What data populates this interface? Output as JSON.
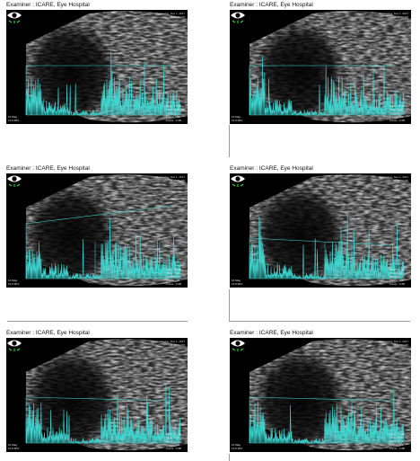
{
  "examiner_label": "Examiner : ICARE, Eye Hospital",
  "colors": {
    "trace": "#3fd7d2",
    "background": "#000000",
    "eye_icon_green": "#2fd23a"
  },
  "panels": [
    {
      "examiner": "Examiner : ICARE, Eye Hospital",
      "timestamp": [
        "Wednesday, Nov 1, 2017",
        "08:02:56 PM"
      ],
      "scan_left": [
        "10 Mag",
        "12.0 Mhz"
      ],
      "scan_right": [
        "Gain : 75 dB",
        "Time : 0-40 mm",
        "Gamma : 0",
        "Frame : 1/1",
        "Focus : 0 dB"
      ]
    },
    {
      "examiner": "Examiner : ICARE, Eye Hospital",
      "timestamp": [
        "Wednesday, Nov 1, 2017",
        "08:02:56 PM"
      ],
      "scan_left": [
        "10 Mag",
        "12.0 Mhz"
      ],
      "scan_right": [
        "Gain : 75 dB",
        "Time : 0-40 mm",
        "Gamma : 0",
        "Frame : 1/1",
        "Focus : 0 dB"
      ]
    },
    {
      "examiner": "Examiner : ICARE, Eye Hospital",
      "timestamp": [
        "Wednesday, Nov 1, 2017",
        "08:02:56 PM"
      ],
      "scan_left": [
        "10 Mag",
        "12.0 Mhz"
      ],
      "scan_right": [
        "Gain : 75 dB",
        "Time : 0-40 mm",
        "Gamma : 0",
        "Frame : 1/1",
        "Focus : 0 dB"
      ]
    },
    {
      "examiner": "Examiner : ICARE, Eye Hospital",
      "timestamp": [
        "Wednesday, Nov 1, 2017",
        "08:02:56 PM"
      ],
      "scan_left": [
        "10 Mag",
        "12.0 Mhz"
      ],
      "scan_right": [
        "Gain : 75 dB",
        "Time : 0-40 mm",
        "Gamma : 0",
        "Frame : 1/1",
        "Focus : 0 dB"
      ]
    },
    {
      "examiner": "Examiner : ICARE, Eye Hospital",
      "timestamp": [
        "Wednesday, Nov 1, 2017",
        "08:02:56 PM"
      ],
      "scan_left": [
        "10 Mag",
        "12.0 Mhz"
      ],
      "scan_right": [
        "Gain : 75 dB",
        "Time : 0-40 mm",
        "Gamma : 0",
        "Frame : 1/1",
        "Focus : 0 dB"
      ]
    },
    {
      "examiner": "Examiner : ICARE, Eye Hospital",
      "timestamp": [
        "Wednesday, Nov 1, 2017",
        "08:02:56 PM"
      ],
      "scan_left": [
        "10 Mag",
        "12.0 Mhz"
      ],
      "scan_right": [
        "Gain : 75 dB",
        "Time : 0-40 mm",
        "Gamma : 0",
        "Frame : 1/1",
        "Focus : 0 dB"
      ]
    }
  ]
}
